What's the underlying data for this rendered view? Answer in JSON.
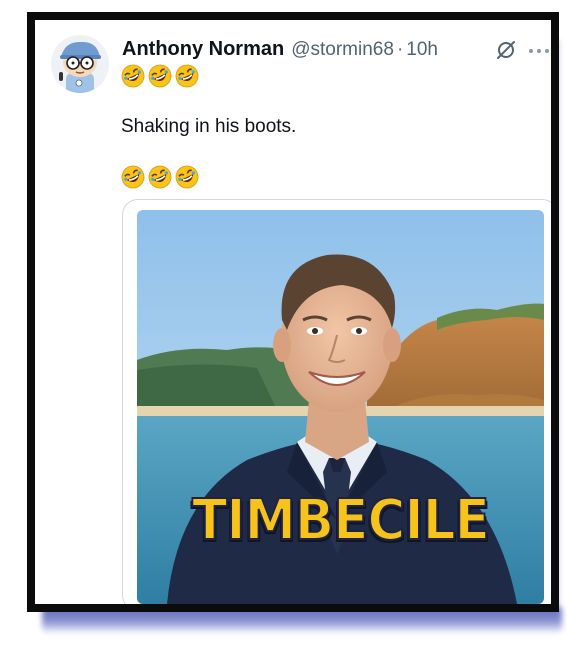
{
  "tweet": {
    "display_name": "Anthony Norman",
    "handle": "@stormin68",
    "separator": "·",
    "time": "10h",
    "emoji_top": [
      "rofl-emoji",
      "rofl-emoji",
      "rofl-emoji"
    ],
    "text": "Shaking in his boots.",
    "emoji_bottom": [
      "rofl-emoji",
      "rofl-emoji",
      "rofl-emoji"
    ]
  },
  "media": {
    "caption": "TIMBECILE"
  },
  "icons": {
    "grok": "grok-slash-circle-icon",
    "more": "more-dots-icon"
  },
  "colors": {
    "frame": "#0b0b0b",
    "shadow": "#5c67b8",
    "caption_fill": "#f6c21c",
    "caption_stroke": "#1f2340",
    "name": "#0f1419",
    "secondary": "#536471"
  }
}
